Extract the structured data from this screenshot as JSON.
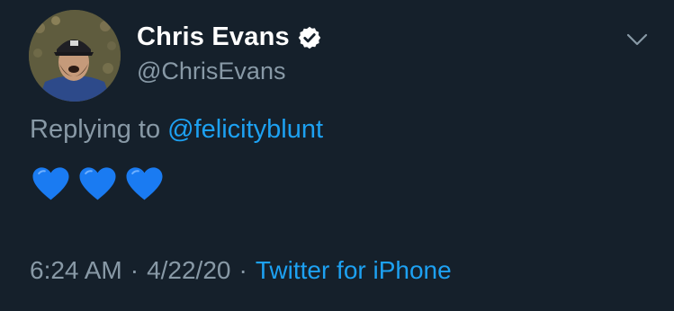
{
  "author": {
    "display_name": "Chris Evans",
    "handle": "@ChrisEvans",
    "verified": true,
    "verified_icon": "verified-badge-icon"
  },
  "reply": {
    "prefix": "Replying to",
    "mention": "@felicityblunt"
  },
  "body": {
    "emojis": [
      "blue-heart",
      "blue-heart",
      "blue-heart"
    ]
  },
  "meta": {
    "time": "6:24 AM",
    "separator": "·",
    "date": "4/22/20",
    "source": "Twitter for iPhone"
  },
  "colors": {
    "background": "#15202b",
    "primary_text": "#ffffff",
    "secondary_text": "#8899a6",
    "link": "#1da1f2",
    "heart": "#1a7bf2"
  }
}
